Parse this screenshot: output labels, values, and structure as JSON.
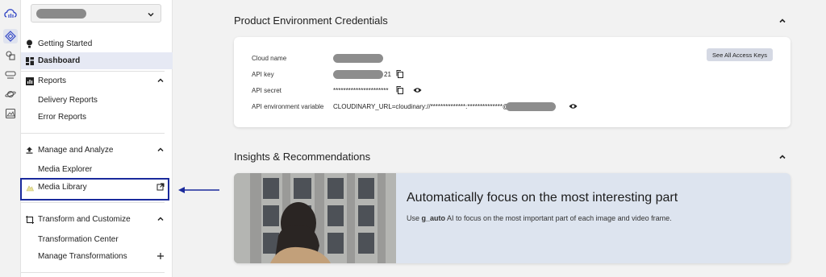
{
  "rail": {
    "icons": [
      "cloud-logo-icon",
      "integration-icon",
      "assets-icon",
      "transform-icon",
      "planet-icon",
      "image-edit-icon"
    ]
  },
  "sidebar": {
    "env_selector": {
      "value_redacted": true
    },
    "items": [
      {
        "label": "Getting Started",
        "icon": "lightbulb-icon"
      },
      {
        "label": "Dashboard",
        "icon": "dashboard-icon"
      },
      {
        "label": "Reports",
        "icon": "bar-chart-icon"
      },
      {
        "label": "Delivery Reports"
      },
      {
        "label": "Error Reports"
      },
      {
        "label": "Manage and Analyze",
        "icon": "upload-icon"
      },
      {
        "label": "Media Explorer"
      },
      {
        "label": "Media Library",
        "icon": "media-library-icon"
      },
      {
        "label": "Transform and Customize",
        "icon": "crop-icon"
      },
      {
        "label": "Transformation Center"
      },
      {
        "label": "Manage Transformations"
      }
    ]
  },
  "credentials": {
    "title": "Product Environment Credentials",
    "see_all_label": "See All Access Keys",
    "rows": [
      {
        "label": "Cloud name"
      },
      {
        "label": "API key",
        "suffix": "21"
      },
      {
        "label": "API secret",
        "value": "**********************"
      },
      {
        "label": "API environment variable",
        "value": "CLOUDINARY_URL=cloudinary://**************:**************@"
      }
    ]
  },
  "insights": {
    "title": "Insights & Recommendations",
    "card_title": "Automatically focus on the most interesting part",
    "desc_prefix": "Use ",
    "desc_bold": "g_auto",
    "desc_suffix": " AI to focus on the most important part of each image and video frame."
  },
  "colors": {
    "accent": "#1a2a9c",
    "active_bg": "#e6e9f4",
    "insight_bg": "#dde4ef"
  }
}
